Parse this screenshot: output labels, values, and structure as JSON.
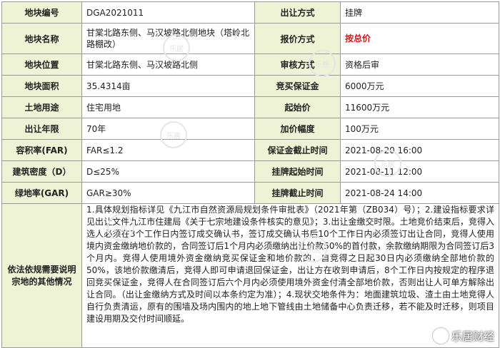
{
  "rows": [
    {
      "label1": "地块编号",
      "value1": "DGA2021011",
      "label2": "出让方式",
      "value2": "挂牌"
    },
    {
      "label1": "地块名称",
      "value1": "甘棠北路东侧、马汉坡路北侧地块（塔岭北路棚改）",
      "label2": "报价方式",
      "value2": "按总价"
    },
    {
      "label1": "地块位置",
      "value1": "甘棠北路东侧、马汉坡路北侧",
      "label2": "审核方式",
      "value2": "资格后审"
    },
    {
      "label1": "地块面积",
      "value1": "35.4314亩",
      "label2": "竞买保证金",
      "value2": "6000万元"
    },
    {
      "label1": "土地用途",
      "value1": "住宅用地",
      "label2": "起始价",
      "value2": "11600万元"
    },
    {
      "label1": "出让年限",
      "value1": "70年",
      "label2": "加价幅度",
      "value2": "100万元"
    },
    {
      "label1": "容积率(FAR)",
      "value1": "FAR≤1.2",
      "label2": "保证金截止时间",
      "value2": "2021-08-20 16:00"
    },
    {
      "label1": "建筑密度（D）",
      "value1": "D≤25%",
      "label2": "挂牌起始时间",
      "value2": "2021-08-11 12:00"
    },
    {
      "label1": "绿地率(GAR)",
      "value1": "GAR≥30%",
      "label2": "挂牌截止时间",
      "value2": "2021-08-24 14:00"
    }
  ],
  "notes": {
    "label": "依法依规需要说明宗地的其他情况",
    "text": "1.具体规划指标详见《九江市自然资源局规划条件审批表》（2021年第（ZB034）号）；2.建设指标要求详见出让文件九江市住建局《关于七宗地建设条件核实的意见》；3.出让金缴交时限。土地竞价结束后，竞得入选人必须在3个工作日内签订成交确认书，签订成交确认书后10个工作日内必须签订出让合同，竞得人使用境内资金缴纳地价款的，合同签订后1个月内必须缴纳出让价款50%的首付款，余款缴纳期限为合同签订后3个月内。竞得人使用境外资金缴纳竞买保证金和地价款的，自竞得之日起30日内必须缴纳全部地价款的50%，该地价款缴清后，竞得人即可申请退回保证金，出让方在收到申请后，8个工作日内按规定的程序退回竞买保证金，竞得人在合同签订后六个月内必须使用境外资金付清全部地价款，否则出让人可单方解除出让合同。（出让金缴纳方式及时间以本条约定为准）；4.现状交地条件为：地面建筑垃圾、渣土由土地竞得人自行负责清运，原有的围墙及场内围内的地上地下管线由土地储备中心负责迁移，若不能及时迁移，则项目建设用期及交付时间顺延。"
  },
  "watermark": {
    "small": "乐居",
    "corner": "乐居财经"
  },
  "colors": {
    "label_bg": "#eef3d6",
    "highlight": "#d9141b",
    "border": "#9a9a9a"
  }
}
